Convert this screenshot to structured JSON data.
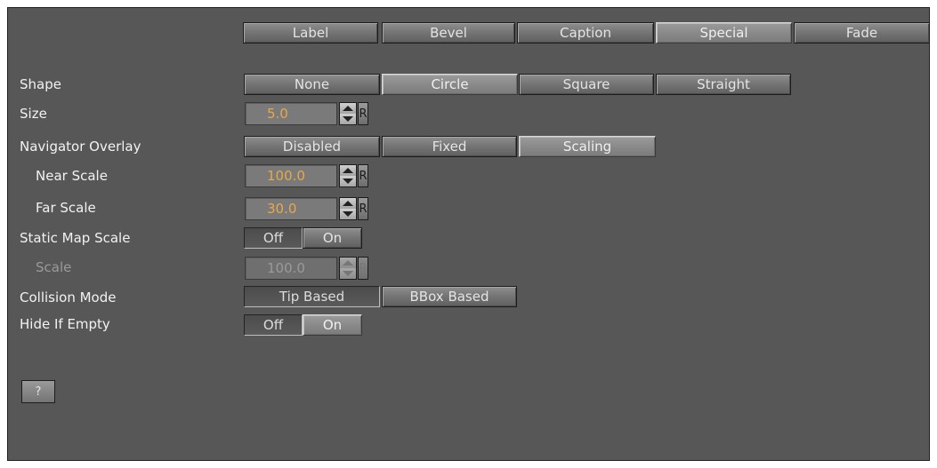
{
  "tabs": [
    "Label",
    "Bevel",
    "Caption",
    "Special",
    "Fade"
  ],
  "active_tab": "Special",
  "shape": {
    "label": "Shape",
    "options": [
      "None",
      "Circle",
      "Square",
      "Straight"
    ],
    "selected": "Circle"
  },
  "size": {
    "label": "Size",
    "value": "5.0",
    "reset_label": "R"
  },
  "navigator_overlay": {
    "label": "Navigator Overlay",
    "options": [
      "Disabled",
      "Fixed",
      "Scaling"
    ],
    "selected": "Scaling"
  },
  "near_scale": {
    "label": "Near Scale",
    "value": "100.0",
    "reset_label": "R"
  },
  "far_scale": {
    "label": "Far Scale",
    "value": "30.0",
    "reset_label": "R"
  },
  "static_map_scale": {
    "label": "Static Map Scale",
    "off_label": "Off",
    "on_label": "On",
    "selected": "Off"
  },
  "scale": {
    "label": "Scale",
    "value": "100.0",
    "reset_label": "R",
    "enabled": false
  },
  "collision_mode": {
    "label": "Collision Mode",
    "options": [
      "Tip Based",
      "BBox Based"
    ],
    "selected": "Tip Based"
  },
  "hide_if_empty": {
    "label": "Hide If Empty",
    "off_label": "Off",
    "on_label": "On",
    "selected": "Off"
  },
  "help_label": "?",
  "colors": {
    "panel_bg": "#575757",
    "value_text": "#e8a84a"
  }
}
